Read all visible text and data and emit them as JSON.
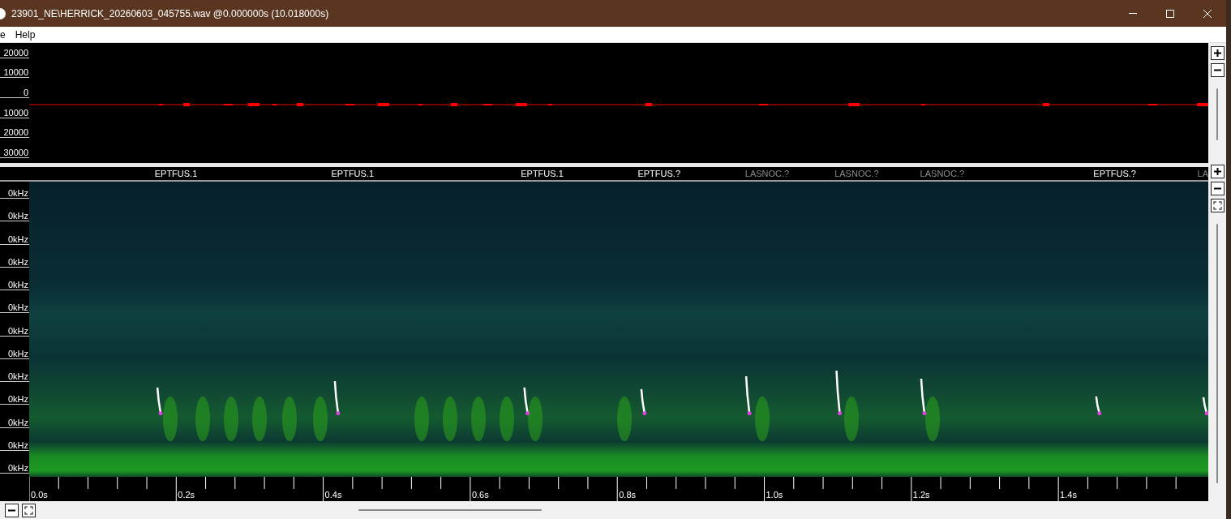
{
  "window": {
    "title": "23901_NE\\HERRICK_20260603_045755.wav @0.000000s (10.018000s)"
  },
  "menu": [
    "e",
    "Help"
  ],
  "waveform": {
    "axis_labels": [
      "20000",
      "10000",
      "0",
      "10000",
      "20000",
      "30000"
    ]
  },
  "spectrogram": {
    "detections": [
      {
        "label": "EPTFUS.1",
        "dimmed": false
      },
      {
        "label": "EPTFUS.1",
        "dimmed": false
      },
      {
        "label": "EPTFUS.1",
        "dimmed": false
      },
      {
        "label": "EPTFUS.?",
        "dimmed": false
      },
      {
        "label": "LASNOC.?",
        "dimmed": true
      },
      {
        "label": "LASNOC.?",
        "dimmed": true
      },
      {
        "label": "LASNOC.?",
        "dimmed": true
      },
      {
        "label": "EPTFUS.?",
        "dimmed": false
      },
      {
        "label": "LA",
        "dimmed": true
      }
    ],
    "axis_labels": [
      "0kHz",
      "0kHz",
      "0kHz",
      "0kHz",
      "0kHz",
      "0kHz",
      "0kHz",
      "0kHz",
      "0kHz",
      "0kHz",
      "0kHz",
      "0kHz",
      "0kHz"
    ],
    "time_labels": [
      "0.0s",
      "0.2s",
      "0.4s",
      "0.6s",
      "0.8s",
      "1.0s",
      "1.2s",
      "1.4s"
    ]
  }
}
